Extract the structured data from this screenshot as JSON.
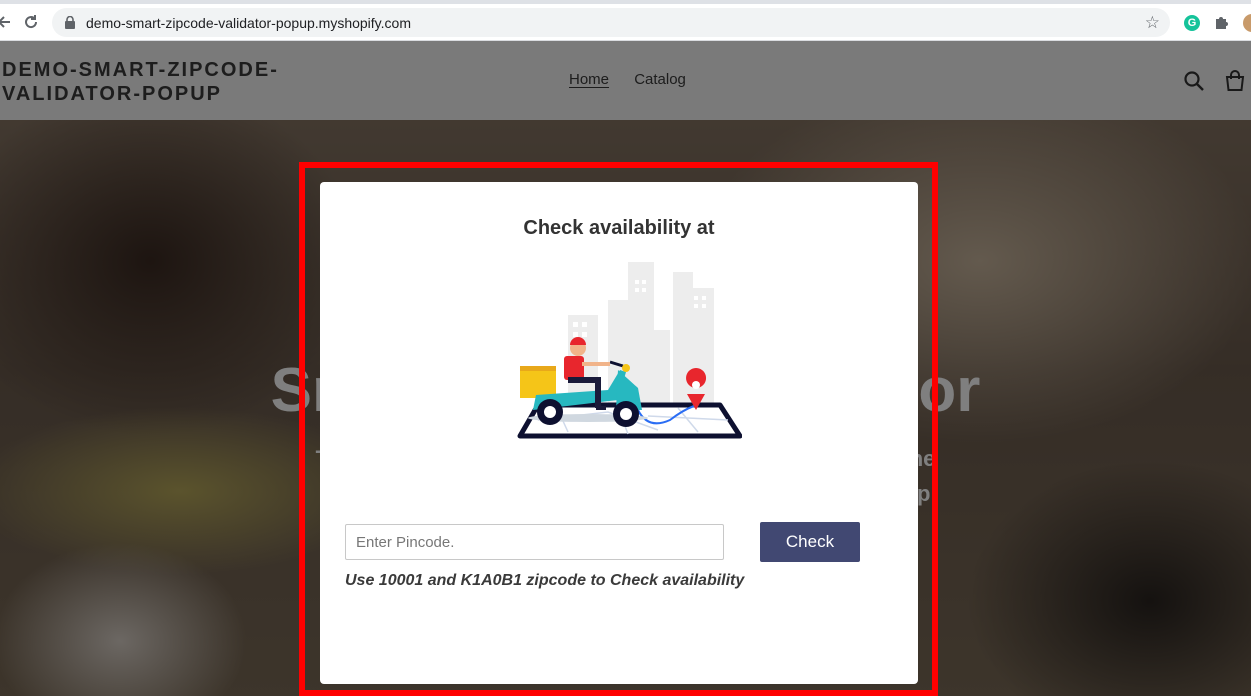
{
  "browser": {
    "url": "demo-smart-zipcode-validator-popup.myshopify.com",
    "back_icon": "back-arrow-icon",
    "reload_icon": "reload-icon",
    "star_icon": "bookmark-star-icon",
    "extension_g_label": "G",
    "extension_icon": "puzzle-icon"
  },
  "site": {
    "brand": "DEMO-SMART-ZIPCODE-VALIDATOR-POPUP",
    "brand_line1": "DEMO-SMART-ZIPCODE-",
    "brand_line2": "VALIDATOR-POPUP",
    "nav": [
      {
        "label": "Home",
        "active": true
      },
      {
        "label": "Catalog",
        "active": false
      }
    ],
    "hero_title": "Smart Zipcode Validator",
    "hero_subtitle_line1": "The Smart Zipcode Validator lets your customers check the",
    "hero_subtitle_line2": "availability of products at their location by entering the zip"
  },
  "modal": {
    "title": "Check availability at",
    "input_placeholder": "Enter Pincode.",
    "input_value": "",
    "check_button": "Check",
    "hint": "Use 10001 and K1A0B1 zipcode to Check availability"
  },
  "colors": {
    "highlight": "#ff0000",
    "button": "#414872",
    "scooter": "#27b8c0",
    "rider_shirt": "#e8262d",
    "map_pin": "#e8262d"
  }
}
